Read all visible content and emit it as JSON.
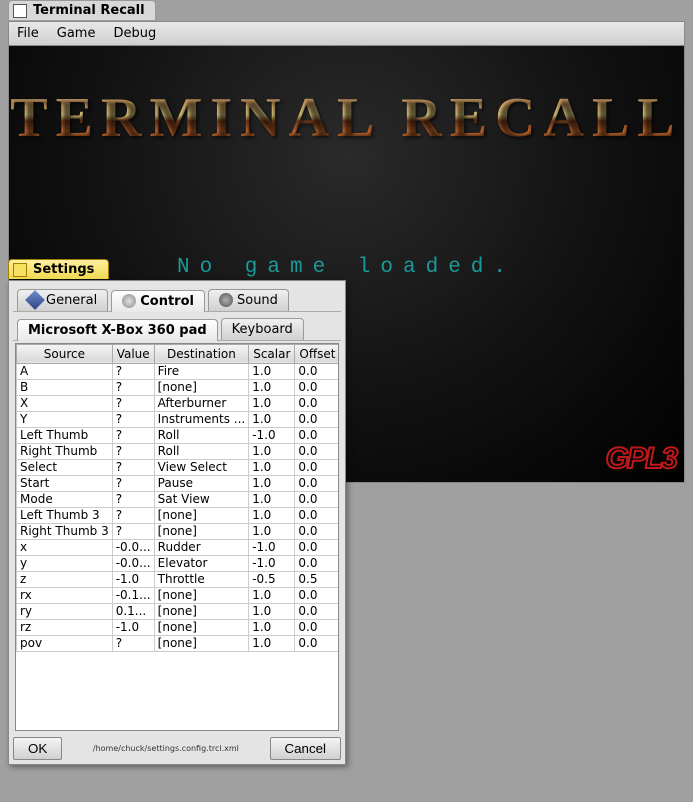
{
  "main_window": {
    "title": "Terminal Recall",
    "menu": {
      "file": "File",
      "game": "Game",
      "debug": "Debug"
    },
    "game_title": "TERMINAL RECALL",
    "status_line": "No game loaded.",
    "badge": "GPL3"
  },
  "settings": {
    "title": "Settings",
    "tabs": {
      "general": "General",
      "control": "Control",
      "sound": "Sound"
    },
    "sub_tabs": {
      "xbox": "Microsoft X-Box 360 pad",
      "keyboard": "Keyboard"
    },
    "columns": {
      "source": "Source",
      "value": "Value",
      "destination": "Destination",
      "scalar": "Scalar",
      "offset": "Offset"
    },
    "rows": [
      {
        "source": "A",
        "value": "?",
        "destination": "Fire",
        "scalar": "1.0",
        "offset": "0.0"
      },
      {
        "source": "B",
        "value": "?",
        "destination": "[none]",
        "scalar": "1.0",
        "offset": "0.0"
      },
      {
        "source": "X",
        "value": "?",
        "destination": "Afterburner",
        "scalar": "1.0",
        "offset": "0.0"
      },
      {
        "source": "Y",
        "value": "?",
        "destination": "Instruments ...",
        "scalar": "1.0",
        "offset": "0.0"
      },
      {
        "source": "Left Thumb",
        "value": "?",
        "destination": "Roll",
        "scalar": "-1.0",
        "offset": "0.0"
      },
      {
        "source": "Right Thumb",
        "value": "?",
        "destination": "Roll",
        "scalar": "1.0",
        "offset": "0.0"
      },
      {
        "source": "Select",
        "value": "?",
        "destination": "View Select",
        "scalar": "1.0",
        "offset": "0.0"
      },
      {
        "source": "Start",
        "value": "?",
        "destination": "Pause",
        "scalar": "1.0",
        "offset": "0.0"
      },
      {
        "source": "Mode",
        "value": "?",
        "destination": "Sat View",
        "scalar": "1.0",
        "offset": "0.0"
      },
      {
        "source": "Left Thumb 3",
        "value": "?",
        "destination": "[none]",
        "scalar": "1.0",
        "offset": "0.0"
      },
      {
        "source": "Right Thumb 3",
        "value": "?",
        "destination": "[none]",
        "scalar": "1.0",
        "offset": "0.0"
      },
      {
        "source": "x",
        "value": "-0.0...",
        "destination": "Rudder",
        "scalar": "-1.0",
        "offset": "0.0"
      },
      {
        "source": "y",
        "value": "-0.0...",
        "destination": "Elevator",
        "scalar": "-1.0",
        "offset": "0.0"
      },
      {
        "source": "z",
        "value": "-1.0",
        "destination": "Throttle",
        "scalar": "-0.5",
        "offset": "0.5"
      },
      {
        "source": "rx",
        "value": "-0.1...",
        "destination": "[none]",
        "scalar": "1.0",
        "offset": "0.0"
      },
      {
        "source": "ry",
        "value": "0.1...",
        "destination": "[none]",
        "scalar": "1.0",
        "offset": "0.0"
      },
      {
        "source": "rz",
        "value": "-1.0",
        "destination": "[none]",
        "scalar": "1.0",
        "offset": "0.0"
      },
      {
        "source": "pov",
        "value": "?",
        "destination": "[none]",
        "scalar": "1.0",
        "offset": "0.0"
      }
    ],
    "path": "/home/chuck/settings.config.trcl.xml",
    "ok": "OK",
    "cancel": "Cancel"
  }
}
